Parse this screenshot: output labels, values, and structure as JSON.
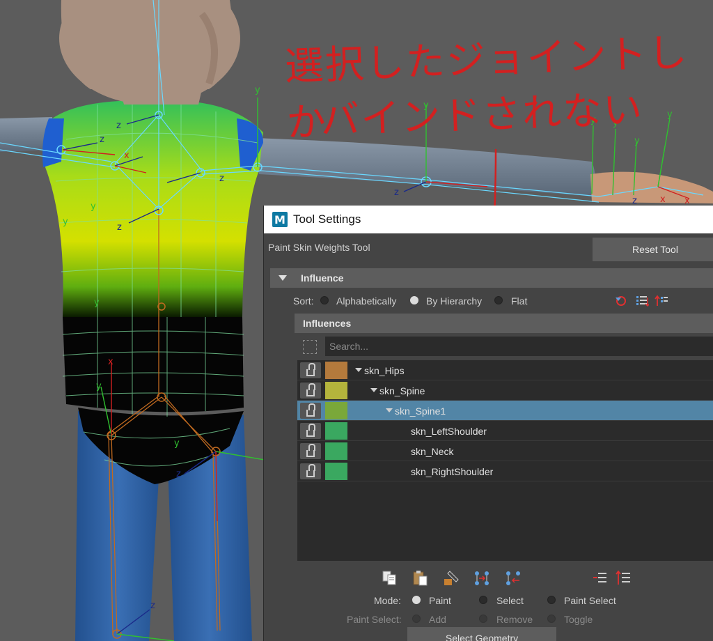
{
  "annotation": {
    "line1": "選択したジョイントしか",
    "line2": "バインドされない"
  },
  "viewport": {
    "axis_x": "x",
    "axis_y": "y",
    "axis_z": "z"
  },
  "window": {
    "app_icon_letter": "M",
    "title": "Tool Settings"
  },
  "tool": {
    "name": "Paint Skin Weights Tool",
    "reset_label": "Reset Tool"
  },
  "influence_section": {
    "title": "Influence",
    "sort_label": "Sort:",
    "sort_options": [
      "Alphabetically",
      "By Hierarchy",
      "Flat"
    ],
    "sort_selected": "By Hierarchy"
  },
  "influences_list": {
    "title": "Influences",
    "search_placeholder": "Search...",
    "items": [
      {
        "label": "skn_Hips",
        "color": "#b47a3c",
        "indent": 0,
        "expanded": true,
        "selected": false
      },
      {
        "label": "skn_Spine",
        "color": "#b4b43c",
        "indent": 1,
        "expanded": true,
        "selected": false
      },
      {
        "label": "skn_Spine1",
        "color": "#7aa83a",
        "indent": 2,
        "expanded": true,
        "selected": true
      },
      {
        "label": "skn_LeftShoulder",
        "color": "#3aa860",
        "indent": 3,
        "expanded": false,
        "selected": false
      },
      {
        "label": "skn_Neck",
        "color": "#3aa860",
        "indent": 3,
        "expanded": false,
        "selected": false
      },
      {
        "label": "skn_RightShoulder",
        "color": "#3aa860",
        "indent": 3,
        "expanded": false,
        "selected": false
      }
    ]
  },
  "mode": {
    "label": "Mode:",
    "options": [
      "Paint",
      "Select",
      "Paint Select"
    ],
    "selected": "Paint"
  },
  "paint_select": {
    "label": "Paint Select:",
    "options": [
      "Add",
      "Remove",
      "Toggle"
    ]
  },
  "buttons": {
    "select_geometry": "Select Geometry"
  }
}
